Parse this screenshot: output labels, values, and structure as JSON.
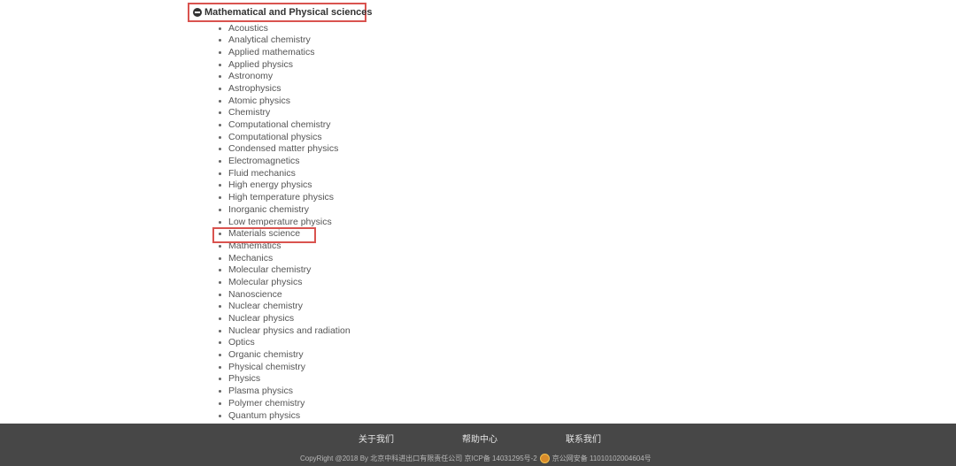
{
  "category": {
    "title": "Mathematical and Physical sciences"
  },
  "subjects": [
    "Acoustics",
    "Analytical chemistry",
    "Applied mathematics",
    "Applied physics",
    "Astronomy",
    "Astrophysics",
    "Atomic physics",
    "Chemistry",
    "Computational chemistry",
    "Computational physics",
    "Condensed matter physics",
    "Electromagnetics",
    "Fluid mechanics",
    "High energy physics",
    "High temperature physics",
    "Inorganic chemistry",
    "Low temperature physics",
    "Materials science",
    "Mathematics",
    "Mechanics",
    "Molecular chemistry",
    "Molecular physics",
    "Nanoscience",
    "Nuclear chemistry",
    "Nuclear physics",
    "Nuclear physics and radiation",
    "Optics",
    "Organic chemistry",
    "Physical chemistry",
    "Physics",
    "Plasma physics",
    "Polymer chemistry",
    "Quantum physics"
  ],
  "highlighted_subject": "Materials science",
  "footer": {
    "links": [
      "关于我们",
      "帮助中心",
      "联系我们"
    ],
    "copyright_left": "CopyRight @2018 By 北京中科进出口有限责任公司 京ICP备 14031295号-2",
    "copyright_right": "京公网安备 11010102004604号"
  },
  "colors": {
    "highlight_border": "#d9534f",
    "footer_background": "#474747"
  }
}
